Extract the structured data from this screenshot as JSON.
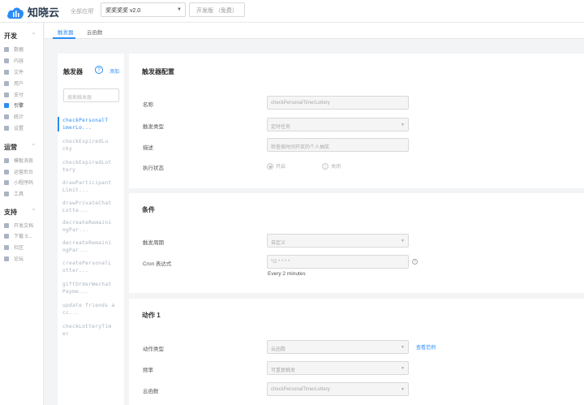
{
  "logo": {
    "text": "知晓云"
  },
  "topbar": {
    "breadcrumb": "全部应用",
    "app_name": "奖奖奖奖 v2.0",
    "plan": "开发版 （免费）"
  },
  "sidebar": {
    "sections": [
      {
        "title": "开发",
        "items": [
          "数据",
          "内容",
          "文件",
          "用户",
          "支付",
          "引擎",
          "统计",
          "设置"
        ]
      },
      {
        "title": "运营",
        "items": [
          "模板消息",
          "运营后台",
          "小程序码",
          "工具"
        ]
      },
      {
        "title": "支持",
        "items": [
          "开发文档",
          "下载 S...",
          "社区",
          "论坛"
        ]
      }
    ]
  },
  "tabs": [
    "触发器",
    "云函数"
  ],
  "triggers": {
    "title": "触发器",
    "add": "添加",
    "search_placeholder": "搜索触发器",
    "items": [
      [
        "checkPersonalT",
        "imerLo..."
      ],
      [
        "checkExpiredLu",
        "cky"
      ],
      [
        "checkExpiredLot",
        "tery"
      ],
      [
        "drawParticipant",
        "Limit..."
      ],
      [
        "drawPrivateChat",
        "Lotte..."
      ],
      [
        "decreateRemaini",
        "ngPar..."
      ],
      [
        "decreateRemaini",
        "ngPar..."
      ],
      [
        "createPersonalL",
        "otter..."
      ],
      [
        "giftOrderWechat",
        "Payme..."
      ],
      [
        "update friends a",
        "cc..."
      ],
      [
        "checkLotteryTim",
        "er"
      ]
    ]
  },
  "config": {
    "title": "触发器配置",
    "name_label": "名称",
    "name_value": "checkPersonalTimerLottery",
    "type_label": "触发类型",
    "type_value": "定时任务",
    "desc_label": "描述",
    "desc_value": "检查按时间开奖的个人抽奖",
    "status_label": "执行状态",
    "status_on": "开启",
    "status_off": "关闭"
  },
  "condition": {
    "title": "条件",
    "period_label": "触发周期",
    "period_value": "自定义",
    "cron_label": "Cron 表达式",
    "cron_value": "*/2 * * * *",
    "cron_desc": "Every 2 minutes"
  },
  "action": {
    "title": "动作 1",
    "type_label": "动作类型",
    "type_value": "云函数",
    "example_link": "查看范例",
    "freq_label": "频率",
    "freq_value": "可重复触发",
    "func_label": "云函数",
    "func_value": "checkPersonalTimerLottery"
  },
  "colors": {
    "accent": "#2b8cf7"
  }
}
